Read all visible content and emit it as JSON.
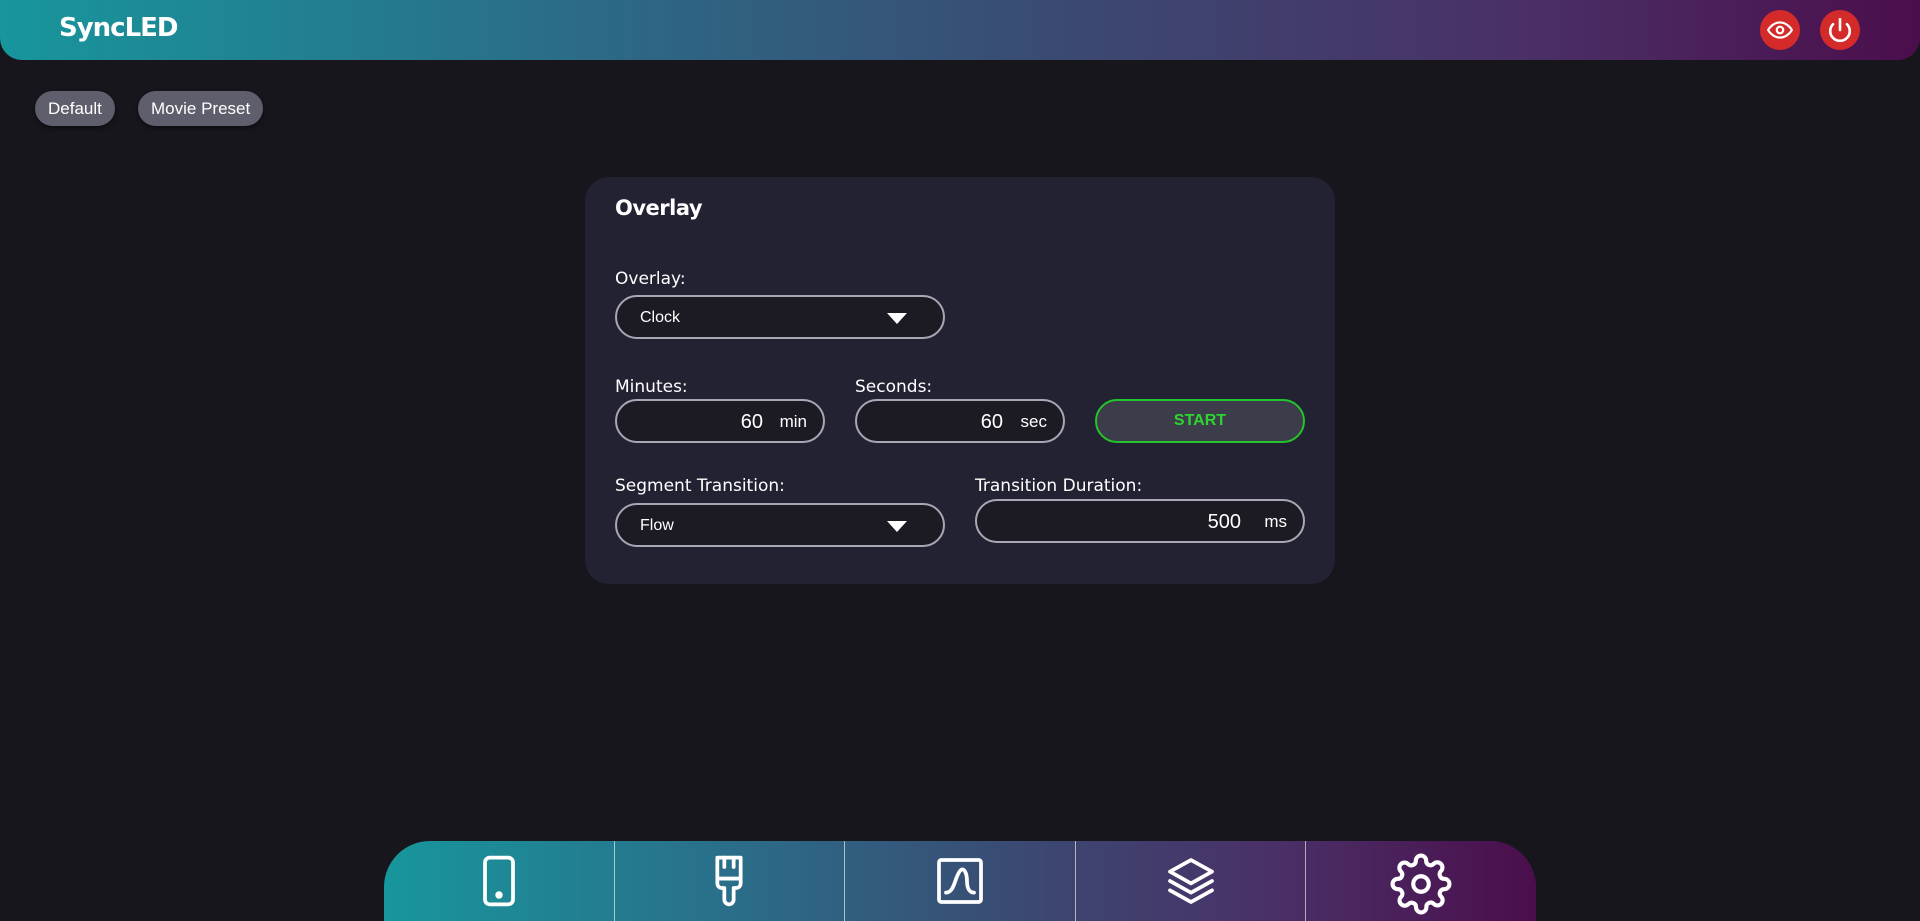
{
  "header": {
    "title": "SyncLED",
    "eye_icon": "eye-icon",
    "power_icon": "power-icon",
    "button_color": "#d42a2a"
  },
  "presets": [
    {
      "label": "Default"
    },
    {
      "label": "Movie Preset"
    }
  ],
  "card": {
    "title": "Overlay",
    "overlay": {
      "label": "Overlay:",
      "value": "Clock"
    },
    "minutes": {
      "label": "Minutes:",
      "value": "60",
      "unit": "min"
    },
    "seconds": {
      "label": "Seconds:",
      "value": "60",
      "unit": "sec"
    },
    "start_label": "START",
    "segment_transition": {
      "label": "Segment Transition:",
      "value": "Flow"
    },
    "transition_duration": {
      "label": "Transition Duration:",
      "value": "500",
      "unit": "ms"
    }
  },
  "bottom_nav": {
    "items": [
      {
        "icon": "phone-icon"
      },
      {
        "icon": "paintbrush-icon"
      },
      {
        "icon": "waveform-icon"
      },
      {
        "icon": "layers-icon"
      },
      {
        "icon": "gear-icon"
      }
    ]
  },
  "colors": {
    "background": "#17161c",
    "card": "#232233",
    "start_green": "#2dd52f"
  }
}
